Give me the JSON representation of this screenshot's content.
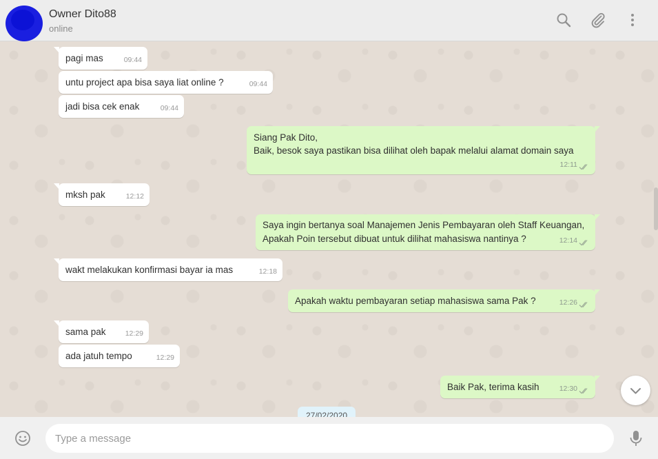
{
  "header": {
    "contact_name": "Owner Dito88",
    "status": "online",
    "icons": [
      "search-icon",
      "attach-icon",
      "menu-icon"
    ]
  },
  "messages": [
    {
      "dir": "in",
      "text": "pagi mas",
      "time": "09:44"
    },
    {
      "dir": "in",
      "text": "untu project apa bisa saya liat online ?",
      "time": "09:44"
    },
    {
      "dir": "in",
      "text": "jadi bisa cek enak",
      "time": "09:44"
    },
    {
      "dir": "out",
      "line1": "Siang Pak Dito,",
      "line2": "Baik, besok saya pastikan bisa dilihat oleh bapak melalui alamat domain saya",
      "time": "12:11",
      "status": "read"
    },
    {
      "dir": "in",
      "text": "mksh pak",
      "time": "12:12"
    },
    {
      "dir": "out",
      "line1": "Saya ingin bertanya soal Manajemen Jenis Pembayaran oleh Staff Keuangan,",
      "line2": "Apakah Poin tersebut dibuat untuk dilihat mahasiswa nantinya ?",
      "time": "12:14",
      "status": "read"
    },
    {
      "dir": "in",
      "text": "wakt melakukan konfirmasi bayar ia mas",
      "time": "12:18"
    },
    {
      "dir": "out",
      "text": "Apakah waktu pembayaran setiap mahasiswa sama Pak ?",
      "time": "12:26",
      "status": "read"
    },
    {
      "dir": "in",
      "text": "sama pak",
      "time": "12:29"
    },
    {
      "dir": "in",
      "text": "ada jatuh tempo",
      "time": "12:29"
    },
    {
      "dir": "out",
      "text": "Baik Pak, terima kasih",
      "time": "12:30",
      "status": "read"
    }
  ],
  "date_separator": "27/02/2020",
  "composer": {
    "placeholder": "Type a message",
    "value": ""
  },
  "colors": {
    "incoming_bubble": "#ffffff",
    "outgoing_bubble": "#dcf8c6",
    "chat_background": "#e5ddd5",
    "read_ticks": "#a0b09a"
  }
}
